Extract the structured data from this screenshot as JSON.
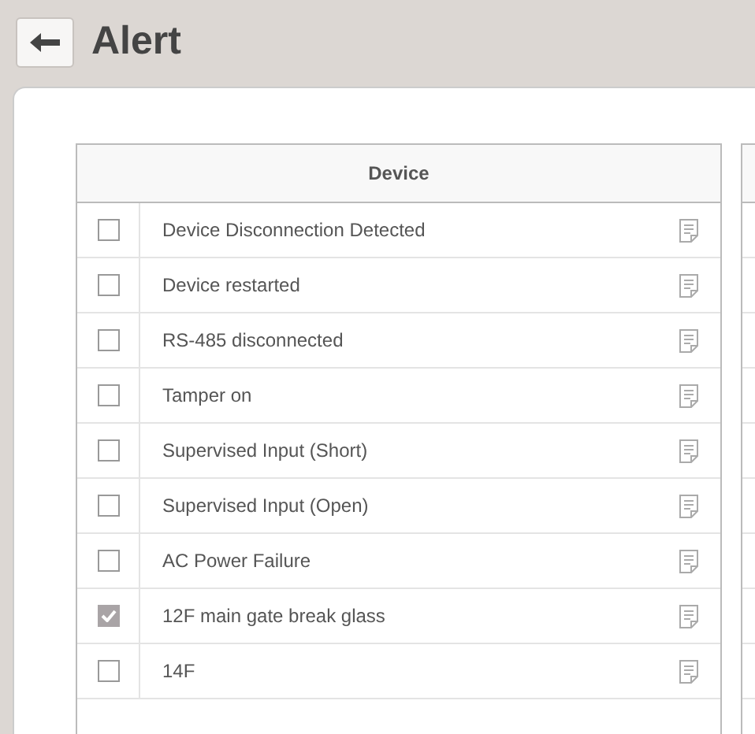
{
  "page": {
    "title": "Alert"
  },
  "table": {
    "columns": [
      "Device"
    ],
    "rows": [
      {
        "name": "Device Disconnection Detected",
        "checked": false
      },
      {
        "name": "Device restarted",
        "checked": false
      },
      {
        "name": "RS-485 disconnected",
        "checked": false
      },
      {
        "name": "Tamper on",
        "checked": false
      },
      {
        "name": "Supervised Input (Short)",
        "checked": false
      },
      {
        "name": "Supervised Input (Open)",
        "checked": false
      },
      {
        "name": "AC Power Failure",
        "checked": false
      },
      {
        "name": "12F main gate break glass",
        "checked": true
      },
      {
        "name": "14F",
        "checked": false
      }
    ]
  }
}
